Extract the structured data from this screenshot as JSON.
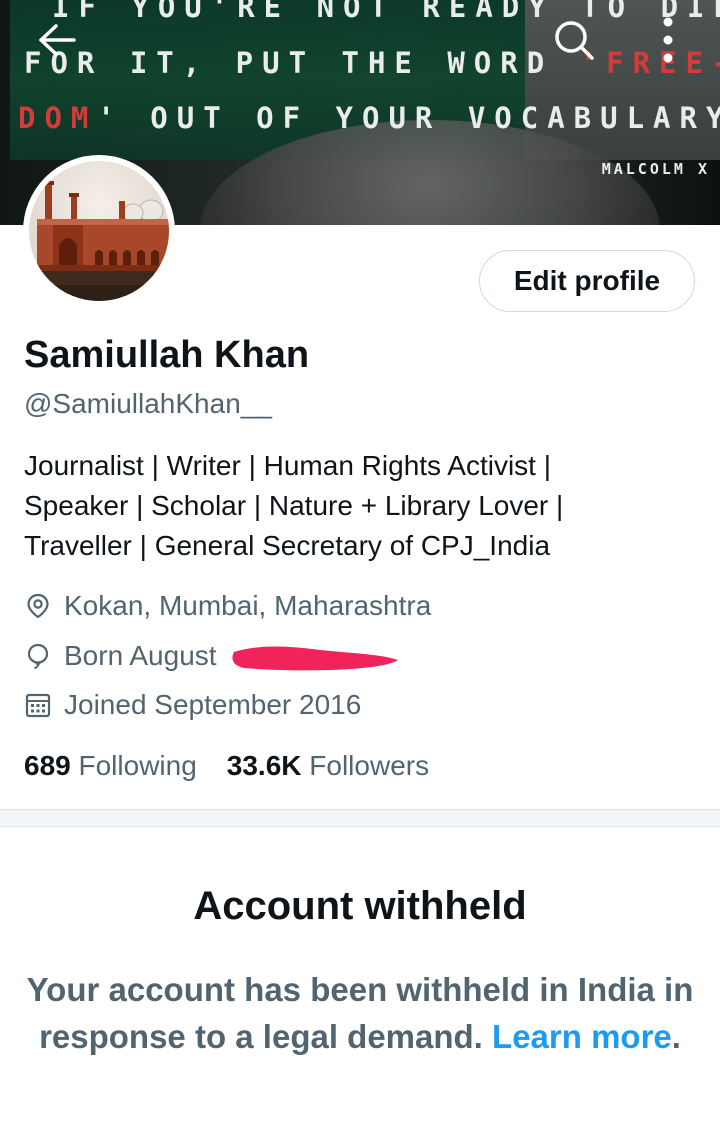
{
  "banner": {
    "quote_line1": "IF YOU'RE NOT READY TO DIE",
    "quote_line2_a": "FOR IT, PUT THE WORD ",
    "quote_line2_b": "'FREE-",
    "quote_line3_a": "DOM",
    "quote_line3_b": "' OUT OF YOUR VOCABULARY.",
    "attribution": "MALCOLM X"
  },
  "header": {
    "back_icon": "arrow-left-icon",
    "search_icon": "search-icon",
    "more_icon": "more-vertical-icon"
  },
  "profile": {
    "edit_label": "Edit profile",
    "display_name": "Samiullah Khan",
    "handle": "@SamiullahKhan__",
    "bio_line1": "Journalist | Writer | Human Rights Activist |",
    "bio_line2": "Speaker | Scholar | Nature + Library Lover |",
    "bio_line3": "Traveller | General Secretary of CPJ_India",
    "location": "Kokan, Mumbai, Maharashtra",
    "born": "Born August",
    "joined": "Joined September 2016",
    "following_count": "689",
    "following_label": "Following",
    "followers_count": "33.6K",
    "followers_label": "Followers"
  },
  "withheld": {
    "title": "Account withheld",
    "message": "Your account has been withheld in India in response to a legal demand.",
    "link": "Learn more",
    "period": "."
  },
  "colors": {
    "link": "#1d9bf0",
    "secondary_text": "#536471",
    "primary_text": "#0f1419",
    "redaction": "#f0245a",
    "quote_red": "#d43b3b"
  }
}
